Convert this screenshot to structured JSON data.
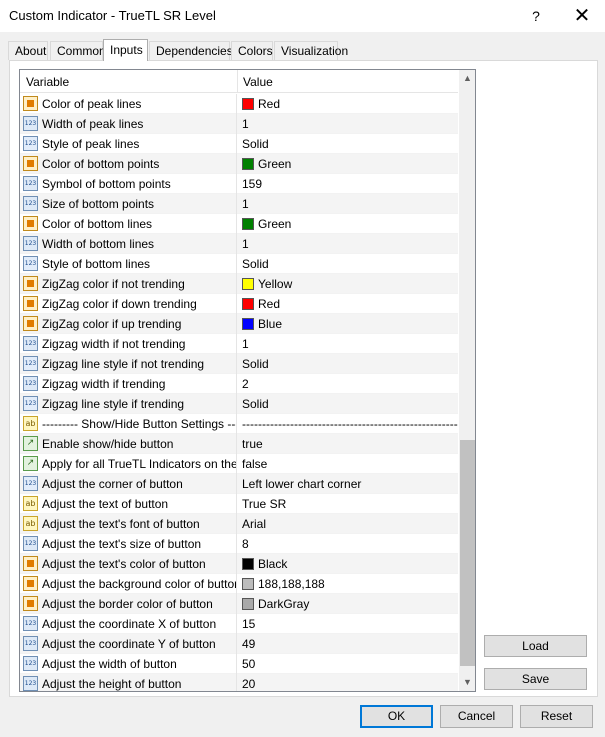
{
  "window": {
    "title": "Custom Indicator - TrueTL SR Level",
    "help_glyph": "?",
    "close_glyph": "✕"
  },
  "tabs": [
    "About",
    "Common",
    "Inputs",
    "Dependencies",
    "Colors",
    "Visualization"
  ],
  "active_tab": "Inputs",
  "grid": {
    "header_variable": "Variable",
    "header_value": "Value",
    "rows": [
      {
        "icon": "color-icon",
        "variable": "Color of peak lines",
        "value": "Red",
        "swatch": "#ff0000"
      },
      {
        "icon": "number-icon",
        "variable": "Width of peak lines",
        "value": "1"
      },
      {
        "icon": "enum-icon",
        "variable": "Style of peak lines",
        "value": "Solid"
      },
      {
        "icon": "color-icon",
        "variable": "Color of bottom points",
        "value": "Green",
        "swatch": "#008000"
      },
      {
        "icon": "number-icon",
        "variable": "Symbol of bottom points",
        "value": "159"
      },
      {
        "icon": "number-icon",
        "variable": "Size of bottom points",
        "value": "1"
      },
      {
        "icon": "color-icon",
        "variable": "Color of bottom lines",
        "value": "Green",
        "swatch": "#008000"
      },
      {
        "icon": "number-icon",
        "variable": "Width of bottom lines",
        "value": "1"
      },
      {
        "icon": "enum-icon",
        "variable": "Style of bottom lines",
        "value": "Solid"
      },
      {
        "icon": "color-icon",
        "variable": "ZigZag color if not trending",
        "value": "Yellow",
        "swatch": "#ffff00"
      },
      {
        "icon": "color-icon",
        "variable": "ZigZag color if down trending",
        "value": "Red",
        "swatch": "#ff0000"
      },
      {
        "icon": "color-icon",
        "variable": "ZigZag color if up trending",
        "value": "Blue",
        "swatch": "#0000ff"
      },
      {
        "icon": "number-icon",
        "variable": "Zigzag width if not trending",
        "value": "1"
      },
      {
        "icon": "enum-icon",
        "variable": "Zigzag line style if not trending",
        "value": "Solid"
      },
      {
        "icon": "number-icon",
        "variable": "Zigzag width if trending",
        "value": "2"
      },
      {
        "icon": "enum-icon",
        "variable": "Zigzag line style if trending",
        "value": "Solid"
      },
      {
        "icon": "text-icon",
        "variable": "--------- Show/Hide Button Settings ---------",
        "value": "---------------------------------------------------------"
      },
      {
        "icon": "bool-icon",
        "variable": "Enable show/hide button",
        "value": "true"
      },
      {
        "icon": "bool-icon",
        "variable": "Apply for all TrueTL Indicators on the c...",
        "value": "false"
      },
      {
        "icon": "enum-icon",
        "variable": "Adjust the corner of button",
        "value": "Left lower chart corner"
      },
      {
        "icon": "text-icon",
        "variable": "Adjust the text of button",
        "value": "True SR"
      },
      {
        "icon": "text-icon",
        "variable": "Adjust the text's font of button",
        "value": "Arial"
      },
      {
        "icon": "number-icon",
        "variable": "Adjust the text's size of button",
        "value": "8"
      },
      {
        "icon": "color-icon",
        "variable": "Adjust the text's color of button",
        "value": "Black",
        "swatch": "#000000"
      },
      {
        "icon": "color-icon",
        "variable": "Adjust the background color of button",
        "value": "188,188,188",
        "swatch": "#bcbcbc"
      },
      {
        "icon": "color-icon",
        "variable": "Adjust the border color of button",
        "value": "DarkGray",
        "swatch": "#a9a9a9"
      },
      {
        "icon": "number-icon",
        "variable": "Adjust the coordinate X of button",
        "value": "15"
      },
      {
        "icon": "number-icon",
        "variable": "Adjust the coordinate Y of button",
        "value": "49"
      },
      {
        "icon": "number-icon",
        "variable": "Adjust the width of button",
        "value": "50"
      },
      {
        "icon": "number-icon",
        "variable": "Adjust the height of button",
        "value": "20"
      }
    ]
  },
  "side_buttons": {
    "load": "Load",
    "save": "Save"
  },
  "footer": {
    "ok": "OK",
    "cancel": "Cancel",
    "reset": "Reset"
  },
  "colors": {
    "accent": "#0078d7",
    "window_bg": "#f0f0f0"
  }
}
